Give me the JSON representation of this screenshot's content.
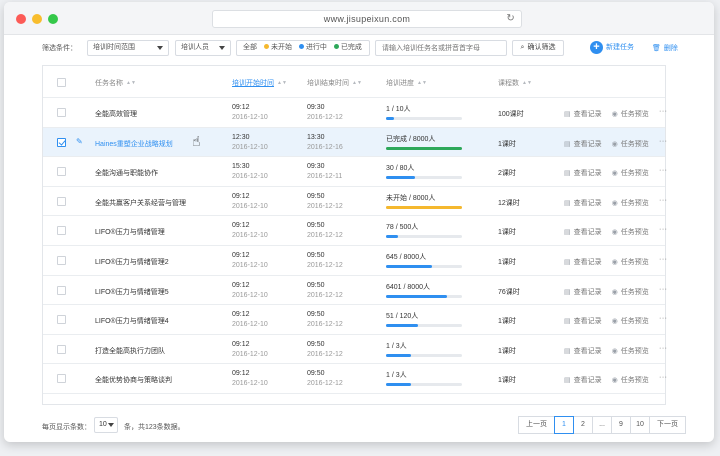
{
  "browser": {
    "url": "www.jisupeixun.com"
  },
  "filters": {
    "label": "筛选条件：",
    "time_range": "培训时间范围",
    "trainer": "培训人员",
    "status_all": "全部",
    "status_not_started": "未开始",
    "status_in_progress": "进行中",
    "status_done": "已完成",
    "search_placeholder": "请输入培训任务名或拼音首字母",
    "confirm_button": "确认筛选",
    "new_task": "新建任务",
    "delete": "删除"
  },
  "colors": {
    "accent": "#2f8ff0",
    "not_started": "#f5b82e",
    "in_progress": "#2f8ff0",
    "done": "#2ea85a"
  },
  "columns": {
    "name": "任务名称",
    "start": "培训开始时间",
    "end": "培训结束时间",
    "progress": "培训进度",
    "hours": "课程数"
  },
  "actions": {
    "view_record": "查看记录",
    "preview": "任务预览",
    "more": "···"
  },
  "rows": [
    {
      "name": "全能高效管理",
      "start_time": "09:12",
      "start_date": "2016-12-10",
      "end_time": "09:30",
      "end_date": "2016-12-12",
      "progress_text": "1 / 10人",
      "progress": 0.1,
      "progress_color": "#2f8ff0",
      "hours": "100课时"
    },
    {
      "name": "Haines重塑企业战略规划",
      "start_time": "12:30",
      "start_date": "2016-12-10",
      "end_time": "13:30",
      "end_date": "2016-12-16",
      "progress_text": "已完成 / 8000人",
      "progress": 1.0,
      "progress_color": "#2ea85a",
      "hours": "1课时"
    },
    {
      "name": "全能沟通与职能协作",
      "start_time": "15:30",
      "start_date": "2016-12-10",
      "end_time": "09:30",
      "end_date": "2016-12-11",
      "progress_text": "30 / 80人",
      "progress": 0.375,
      "progress_color": "#2f8ff0",
      "hours": "2课时"
    },
    {
      "name": "全能共赢客户关系经营与管理",
      "start_time": "09:12",
      "start_date": "2016-12-10",
      "end_time": "09:50",
      "end_date": "2016-12-12",
      "progress_text": "未开始 / 8000人",
      "progress": 1.0,
      "progress_color": "#f5b82e",
      "hours": "12课时"
    },
    {
      "name": "LIFO®压力与情绪管理",
      "start_time": "09:12",
      "start_date": "2016-12-10",
      "end_time": "09:50",
      "end_date": "2016-12-12",
      "progress_text": "78 / 500人",
      "progress": 0.156,
      "progress_color": "#2f8ff0",
      "hours": "1课时"
    },
    {
      "name": "LIFO®压力与情绪管理2",
      "start_time": "09:12",
      "start_date": "2016-12-10",
      "end_time": "09:50",
      "end_date": "2016-12-12",
      "progress_text": "645 / 8000人",
      "progress": 0.6,
      "progress_color": "#2f8ff0",
      "hours": "1课时"
    },
    {
      "name": "LIFO®压力与情绪管理5",
      "start_time": "09:12",
      "start_date": "2016-12-10",
      "end_time": "09:50",
      "end_date": "2016-12-12",
      "progress_text": "6401 / 8000人",
      "progress": 0.8,
      "progress_color": "#2f8ff0",
      "hours": "76课时"
    },
    {
      "name": "LIFO®压力与情绪管理4",
      "start_time": "09:12",
      "start_date": "2016-12-10",
      "end_time": "09:50",
      "end_date": "2016-12-12",
      "progress_text": "51 / 120人",
      "progress": 0.425,
      "progress_color": "#2f8ff0",
      "hours": "1课时"
    },
    {
      "name": "打造全能高执行力团队",
      "start_time": "09:12",
      "start_date": "2016-12-10",
      "end_time": "09:50",
      "end_date": "2016-12-12",
      "progress_text": "1 / 3人",
      "progress": 0.33,
      "progress_color": "#2f8ff0",
      "hours": "1课时"
    },
    {
      "name": "全能优势协商与策略谈判",
      "start_time": "09:12",
      "start_date": "2016-12-10",
      "end_time": "09:50",
      "end_date": "2016-12-12",
      "progress_text": "1 / 3人",
      "progress": 0.33,
      "progress_color": "#2f8ff0",
      "hours": "1课时"
    }
  ],
  "footer": {
    "page_size_label": "每页显示条数：",
    "page_size": "10",
    "total": "条，共123条数据。",
    "prev": "上一页",
    "pages": [
      "1",
      "2",
      "...",
      "9",
      "10"
    ],
    "current_page": "1",
    "next": "下一页"
  }
}
